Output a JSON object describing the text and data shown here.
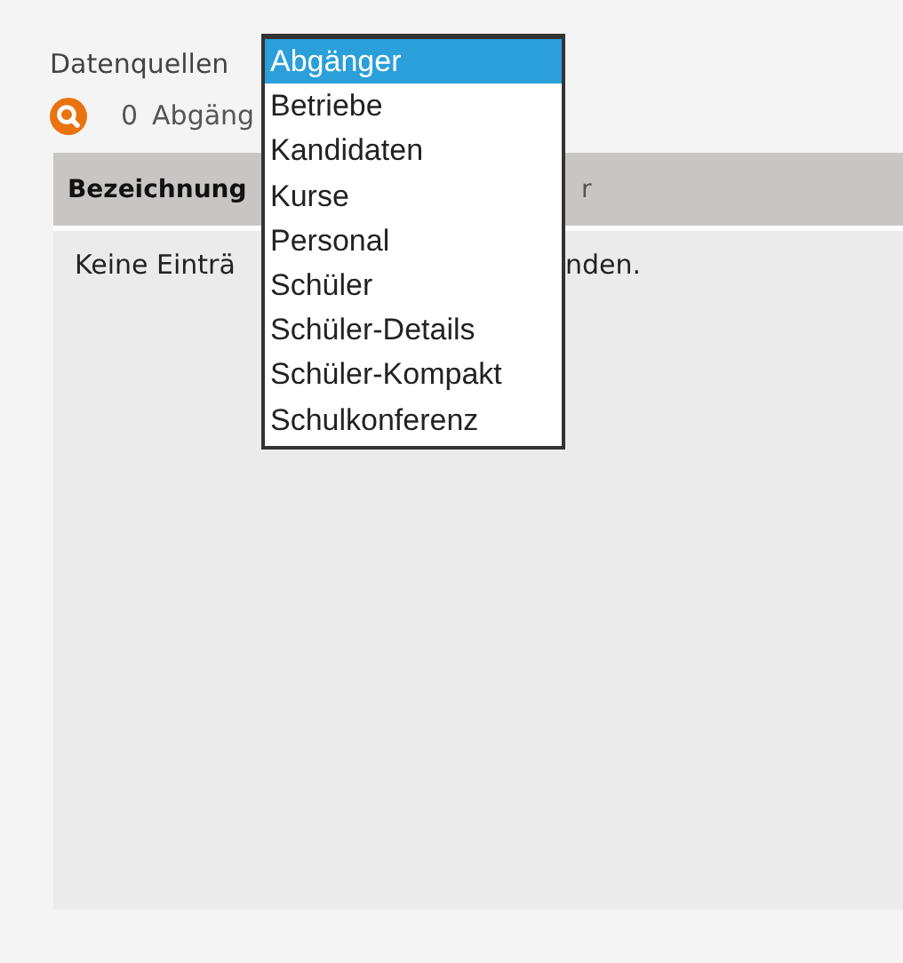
{
  "source_label": "Datenquellen",
  "count": {
    "value": "0",
    "label": "Abgäng"
  },
  "table": {
    "columns": [
      "Bezeichnung",
      "r"
    ],
    "empty_message": {
      "before": "Keine Einträ",
      "after": "nden."
    }
  },
  "dropdown": {
    "options": [
      {
        "label": "Abgänger",
        "selected": true
      },
      {
        "label": "Betriebe",
        "selected": false
      },
      {
        "label": "Kandidaten",
        "selected": false
      },
      {
        "label": "Kurse",
        "selected": false
      },
      {
        "label": "Personal",
        "selected": false
      },
      {
        "label": "Schüler",
        "selected": false
      },
      {
        "label": "Schüler-Details",
        "selected": false
      },
      {
        "label": "Schüler-Kompakt",
        "selected": false
      },
      {
        "label": "Schulkonferenz",
        "selected": false
      }
    ]
  }
}
